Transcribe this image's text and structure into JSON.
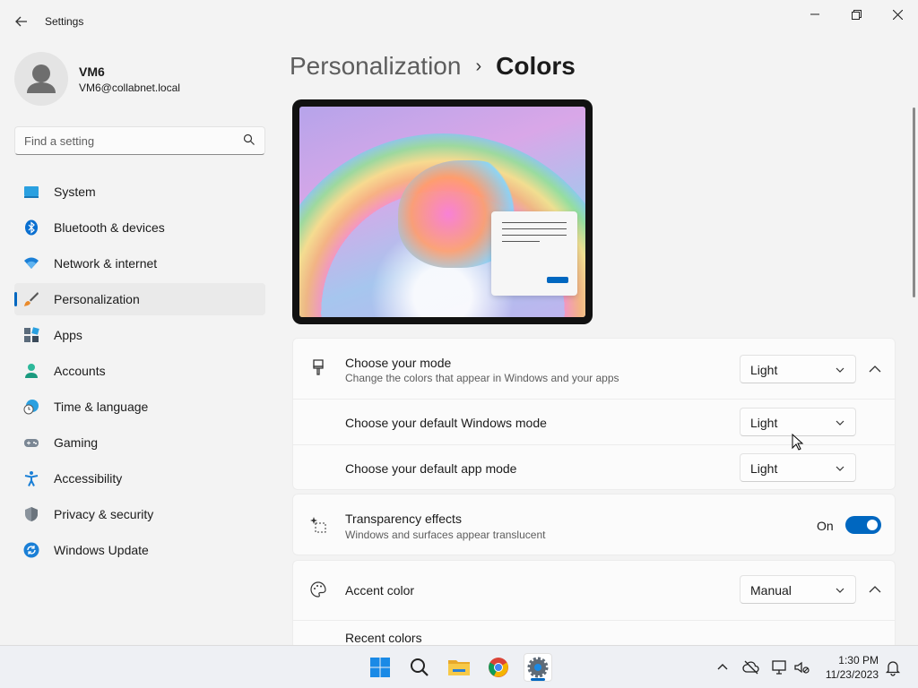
{
  "window": {
    "app_title": "Settings",
    "back_icon": "back-arrow-icon",
    "minimize_icon": "minimize-icon",
    "restore_icon": "restore-icon",
    "close_icon": "close-icon"
  },
  "user": {
    "name": "VM6",
    "email": "VM6@collabnet.local"
  },
  "search": {
    "placeholder": "Find a setting"
  },
  "sidebar": {
    "items": [
      {
        "label": "System",
        "icon": "system-icon"
      },
      {
        "label": "Bluetooth & devices",
        "icon": "bluetooth-icon"
      },
      {
        "label": "Network & internet",
        "icon": "wifi-icon"
      },
      {
        "label": "Personalization",
        "icon": "brush-icon",
        "active": true
      },
      {
        "label": "Apps",
        "icon": "apps-icon"
      },
      {
        "label": "Accounts",
        "icon": "accounts-icon"
      },
      {
        "label": "Time & language",
        "icon": "clock-globe-icon"
      },
      {
        "label": "Gaming",
        "icon": "gamepad-icon"
      },
      {
        "label": "Accessibility",
        "icon": "accessibility-icon"
      },
      {
        "label": "Privacy & security",
        "icon": "shield-icon"
      },
      {
        "label": "Windows Update",
        "icon": "update-icon"
      }
    ]
  },
  "breadcrumb": {
    "parent": "Personalization",
    "separator": "›",
    "current": "Colors"
  },
  "mode": {
    "title": "Choose your mode",
    "subtitle": "Change the colors that appear in Windows and your apps",
    "value": "Light",
    "windows_mode_label": "Choose your default Windows mode",
    "windows_mode_value": "Light",
    "app_mode_label": "Choose your default app mode",
    "app_mode_value": "Light"
  },
  "transparency": {
    "title": "Transparency effects",
    "subtitle": "Windows and surfaces appear translucent",
    "state": "On"
  },
  "accent": {
    "title": "Accent color",
    "value": "Manual",
    "recent_label": "Recent colors"
  },
  "taskbar": {
    "time": "1:30 PM",
    "date": "11/23/2023"
  },
  "colors": {
    "accent": "#0067c0"
  }
}
